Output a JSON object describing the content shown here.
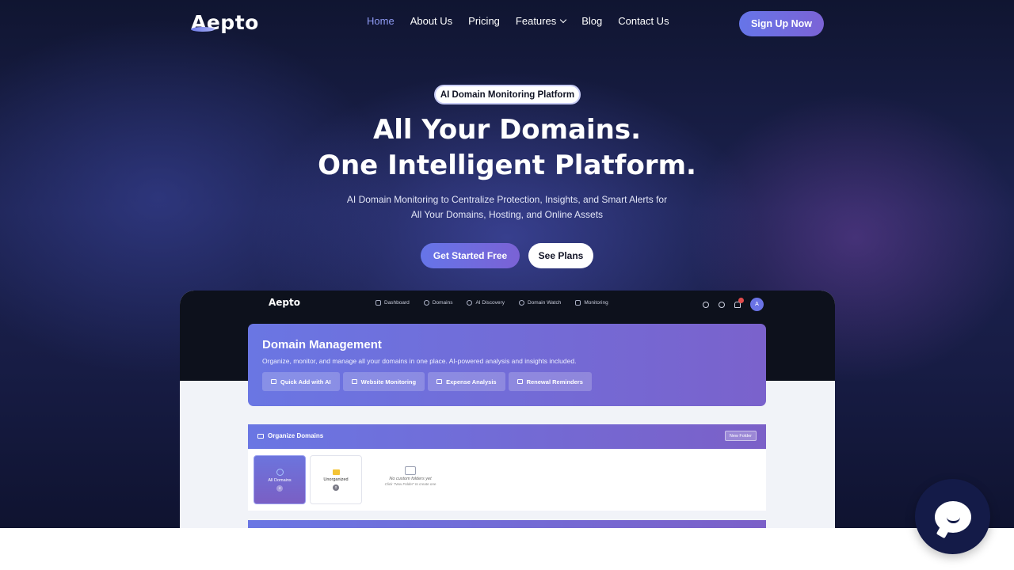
{
  "nav": {
    "logo": "Aepto",
    "links": [
      {
        "label": "Home",
        "active": true
      },
      {
        "label": "About Us"
      },
      {
        "label": "Pricing"
      },
      {
        "label": "Features",
        "has_dropdown": true
      },
      {
        "label": "Blog"
      },
      {
        "label": "Contact Us"
      }
    ],
    "signup_label": "Sign Up Now"
  },
  "hero": {
    "badge": "AI Domain Monitoring Platform",
    "headline_line1": "All Your Domains.",
    "headline_line2": "One Intelligent Platform.",
    "sub_line1": "AI Domain Monitoring to Centralize Protection, Insights, and Smart Alerts for",
    "sub_line2": "All Your Domains, Hosting, and Online Assets",
    "cta_primary": "Get Started Free",
    "cta_secondary": "See Plans"
  },
  "preview": {
    "logo": "Aepto",
    "nav": [
      {
        "label": "Dashboard",
        "icon": "dashboard-icon"
      },
      {
        "label": "Domains",
        "icon": "globe-icon",
        "has_dropdown": true
      },
      {
        "label": "AI Discovery",
        "icon": "search-icon"
      },
      {
        "label": "Domain Watch",
        "icon": "eye-icon"
      },
      {
        "label": "Monitoring",
        "icon": "monitor-icon",
        "has_dropdown": true
      }
    ],
    "avatar": "A",
    "card": {
      "title": "Domain Management",
      "description": "Organize, monitor, and manage all your domains in one place. AI-powered analysis and insights included.",
      "buttons": [
        "Quick Add with AI",
        "Website Monitoring",
        "Expense Analysis",
        "Renewal Reminders"
      ]
    },
    "organize": {
      "title": "Organize Domains",
      "new_folder": "New Folder",
      "tiles": [
        {
          "label": "All Domains",
          "count": "4"
        },
        {
          "label": "Unorganized",
          "count": "0"
        }
      ],
      "empty_title": "No custom folders yet",
      "empty_hint": "Click \"New Folder\" to create one"
    }
  },
  "colors": {
    "accent": "#6675e8",
    "accent_purple": "#7a62d5",
    "hero_bg": "#1c2250"
  }
}
